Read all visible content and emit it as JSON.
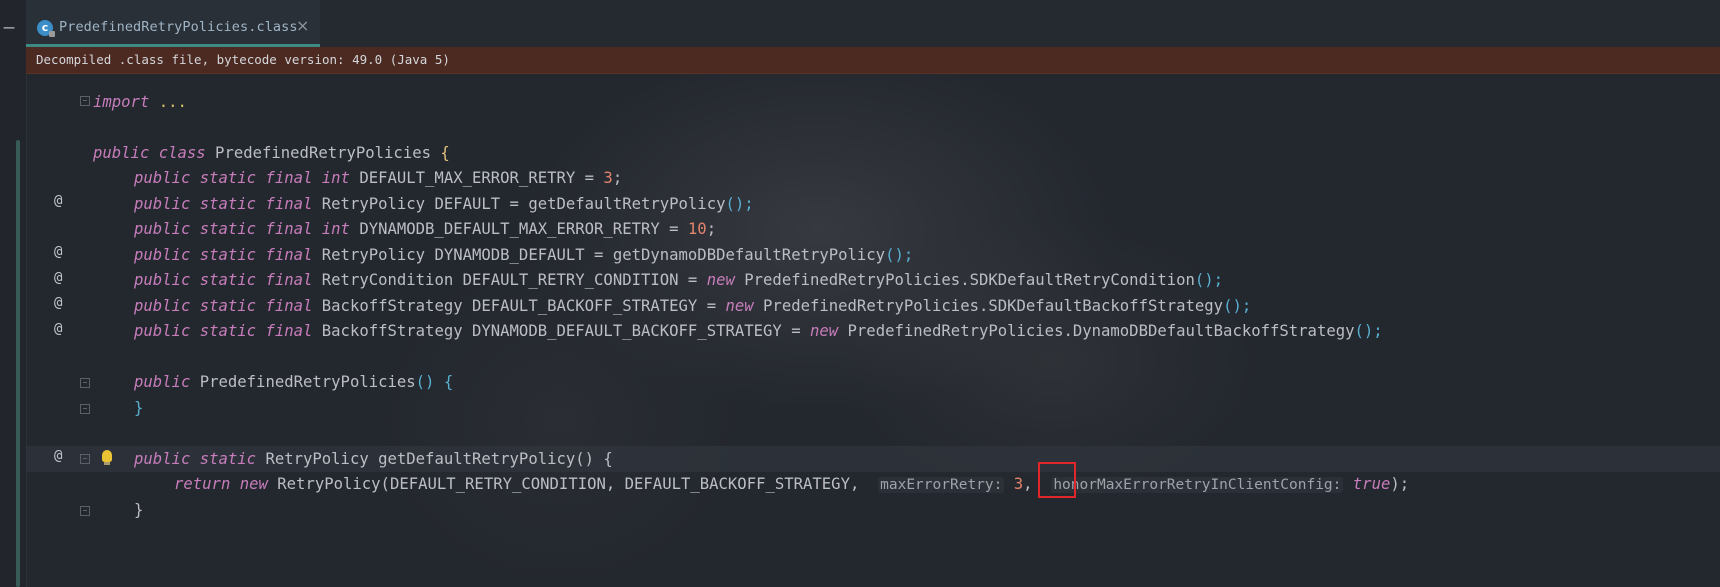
{
  "window": {
    "collapse_label": "—"
  },
  "tab": {
    "icon_letter": "c",
    "title": "PredefinedRetryPolicies.class",
    "close_label": "×"
  },
  "banner": {
    "text": "Decompiled .class file, bytecode version: 49.0 (Java 5)"
  },
  "gutter": {
    "at_symbol": "@"
  },
  "code": {
    "import_kw": "import",
    "import_dots": " ...",
    "class_decl": {
      "mods": "public class",
      "name": " PredefinedRetryPolicies ",
      "brace": "{"
    },
    "fields": [
      {
        "mods": "public static final int",
        "rest": " DEFAULT_MAX_ERROR_RETRY = ",
        "value": "3",
        "end": ";"
      },
      {
        "mods": "public static final",
        "rest": " RetryPolicy DEFAULT = getDefaultRetryPolicy",
        "end": "();"
      },
      {
        "mods": "public static final int",
        "rest": " DYNAMODB_DEFAULT_MAX_ERROR_RETRY = ",
        "value": "10",
        "end": ";"
      },
      {
        "mods": "public static final",
        "rest": " RetryPolicy DYNAMODB_DEFAULT = getDynamoDBDefaultRetryPolicy",
        "end": "();"
      },
      {
        "mods": "public static final",
        "rest": " RetryCondition DEFAULT_RETRY_CONDITION = ",
        "new_kw": "new",
        "ctor": " PredefinedRetryPolicies.SDKDefaultRetryCondition",
        "end": "();"
      },
      {
        "mods": "public static final",
        "rest": " BackoffStrategy DEFAULT_BACKOFF_STRATEGY = ",
        "new_kw": "new",
        "ctor": " PredefinedRetryPolicies.SDKDefaultBackoffStrategy",
        "end": "();"
      },
      {
        "mods": "public static final",
        "rest": " BackoffStrategy DYNAMODB_DEFAULT_BACKOFF_STRATEGY = ",
        "new_kw": "new",
        "ctor": " PredefinedRetryPolicies.DynamoDBDefaultBackoffStrategy",
        "end": "();"
      }
    ],
    "ctor_decl": {
      "mods": "public",
      "name": " PredefinedRetryPolicies",
      "parens": "()",
      "brace": " {"
    },
    "close_brace": "}",
    "method_decl": {
      "mods": "public static",
      "rest": " RetryPolicy getDefaultRetryPolicy",
      "parens": "()",
      "brace": " {"
    },
    "return_stmt": {
      "kw": "return new",
      "call": " RetryPolicy(DEFAULT_RETRY_CONDITION, DEFAULT_BACKOFF_STRATEGY, ",
      "hint1": "maxErrorRetry:",
      "value1": "3",
      "comma": ",",
      "hint2": "honorMaxErrorRetryInClientConfig:",
      "value2": "true",
      "end": ");"
    }
  },
  "colors": {
    "keyword": "#c77dbb",
    "number": "#e3856c",
    "highlight_box": "#e0262a",
    "banner_bg": "#4c2a22"
  }
}
